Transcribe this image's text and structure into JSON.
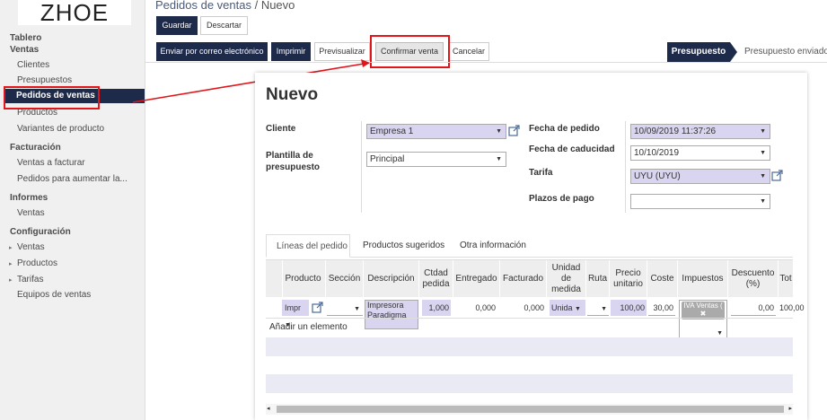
{
  "brand": {
    "logo_text": "ZHOE"
  },
  "sidebar": {
    "sections": [
      {
        "title": "Tablero"
      },
      {
        "title": "Ventas",
        "items": [
          "Clientes",
          "Presupuestos",
          "Pedidos de ventas",
          "Productos",
          "Variantes de producto"
        ]
      },
      {
        "title": "Facturación",
        "items": [
          "Ventas a facturar",
          "Pedidos para aumentar la..."
        ]
      },
      {
        "title": "Informes",
        "items": [
          "Ventas"
        ]
      },
      {
        "title": "Configuración",
        "items": [
          "Ventas",
          "Productos",
          "Tarifas",
          "Equipos de ventas"
        ]
      }
    ],
    "active_item": "Pedidos de ventas"
  },
  "header": {
    "breadcrumb_root": "Pedidos de ventas",
    "breadcrumb_sep": " / ",
    "breadcrumb_current": "Nuevo",
    "save_label": "Guardar",
    "discard_label": "Descartar"
  },
  "actions": {
    "send_email": "Enviar por correo electrónico",
    "print": "Imprimir",
    "preview": "Previsualizar",
    "confirm": "Confirmar venta",
    "cancel": "Cancelar"
  },
  "status": {
    "current": "Presupuesto",
    "next": "Presupuesto enviado"
  },
  "form": {
    "title": "Nuevo",
    "customer_label": "Cliente",
    "customer_value": "Empresa 1",
    "template_label": "Plantilla de presupuesto",
    "template_value": "Principal",
    "order_date_label": "Fecha de pedido",
    "order_date_value": "10/09/2019 11:37:26",
    "expiry_label": "Fecha de caducidad",
    "expiry_value": "10/10/2019",
    "pricelist_label": "Tarifa",
    "pricelist_value": "UYU (UYU)",
    "payment_terms_label": "Plazos de pago",
    "payment_terms_value": ""
  },
  "tabs": [
    "Líneas del pedido",
    "Productos sugeridos",
    "Otra información"
  ],
  "table": {
    "headers": [
      "Producto",
      "Sección",
      "Descripción",
      "Ctdad pedida",
      "Entregado",
      "Facturado",
      "Unidad de medida",
      "Ruta",
      "Precio unitario",
      "Coste",
      "Impuestos",
      "Descuento (%)",
      "Tot"
    ],
    "row": {
      "product": "Impr",
      "section": "",
      "description": "Impresora Paradigma",
      "qty": "1,000",
      "delivered": "0,000",
      "invoiced": "0,000",
      "uom": "Unida",
      "route": "",
      "price": "100,00",
      "cost": "30,00",
      "tax": "IVA Ventas (",
      "discount": "0,00",
      "total": "100,00"
    },
    "add_item": "Añadir un elemento"
  },
  "colors": {
    "primary": "#1d2a4a",
    "highlight_red": "#e0161b",
    "field_purple": "#d9d4f0"
  }
}
